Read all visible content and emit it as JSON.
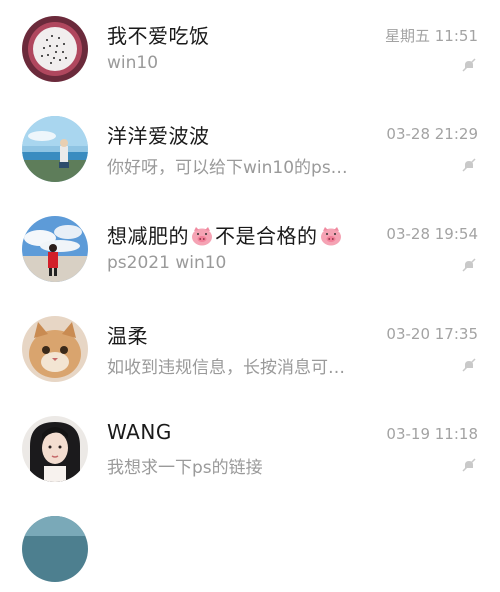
{
  "chats": [
    {
      "name": "我不爱吃饭",
      "preview": "win10",
      "time": "星期五 11:51",
      "avatar": "dragon-fruit-avatar"
    },
    {
      "name": "洋洋爱波波",
      "preview": "你好呀，可以给下win10的ps…",
      "time": "03-28 21:29",
      "avatar": "beach-person-avatar"
    },
    {
      "name_before": "想减肥的",
      "name_middle": "不是合格的",
      "preview": "ps2021 win10",
      "time": "03-28 19:54",
      "avatar": "sky-girl-avatar"
    },
    {
      "name": "温柔",
      "preview": "如收到违规信息，长按消息可…",
      "time": "03-20 17:35",
      "avatar": "cat-avatar"
    },
    {
      "name": "WANG",
      "preview": "我想求一下ps的链接",
      "time": "03-19 11:18",
      "avatar": "portrait-avatar"
    },
    {
      "name": "",
      "preview": "",
      "time": "",
      "avatar": "partial-avatar"
    }
  ],
  "icons": {
    "mute": "mute-bell-icon",
    "pig": "pig-emoji-icon"
  }
}
